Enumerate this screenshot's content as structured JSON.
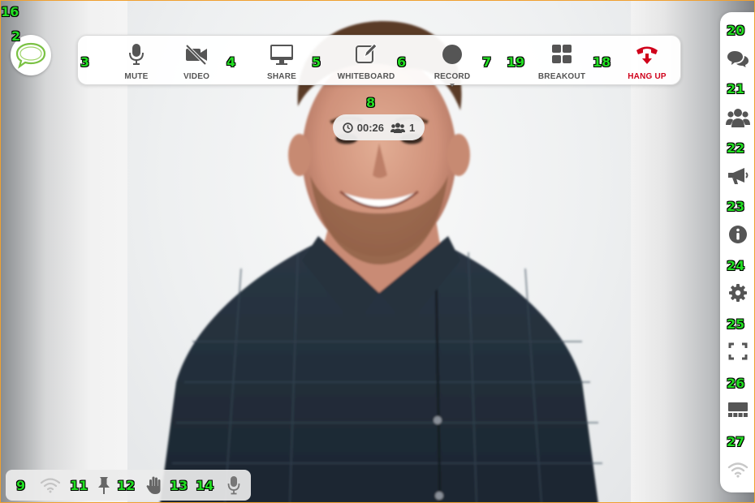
{
  "labels": {
    "l16": "16",
    "l2": "2",
    "l3": "3",
    "l4": "4",
    "l5": "5",
    "l6": "6",
    "l7": "7",
    "l19": "19",
    "l18": "18",
    "l8": "8",
    "l20": "20",
    "l21": "21",
    "l22": "22",
    "l23": "23",
    "l24": "24",
    "l25": "25",
    "l26": "26",
    "l27": "27",
    "l9": "9",
    "l11": "11",
    "l12": "12",
    "l13": "13",
    "l14": "14"
  },
  "logo": {
    "icon": "chat-bubble-logo-icon",
    "color": "#7ac143"
  },
  "toolbar": {
    "mute_label": "MUTE",
    "video_label": "VIDEO",
    "share_label": "SHARE",
    "whiteboard_label": "WHITEBOARD",
    "record_label": "RECORD",
    "breakout_label": "BREAKOUT",
    "hangup_label": "HANG UP",
    "hangup_color": "#d0021b",
    "icon_color": "#555555"
  },
  "timer": {
    "elapsed": "00:26",
    "participants": "1"
  },
  "rail": {
    "items": [
      "chat-icon",
      "participants-icon",
      "megaphone-icon",
      "info-icon",
      "gear-icon",
      "fullscreen-icon",
      "layout-icon",
      "wifi-icon"
    ]
  },
  "statusbar": {
    "items": [
      "wifi-signal-icon",
      "pin-icon",
      "raise-hand-icon",
      "microphone-icon"
    ]
  }
}
